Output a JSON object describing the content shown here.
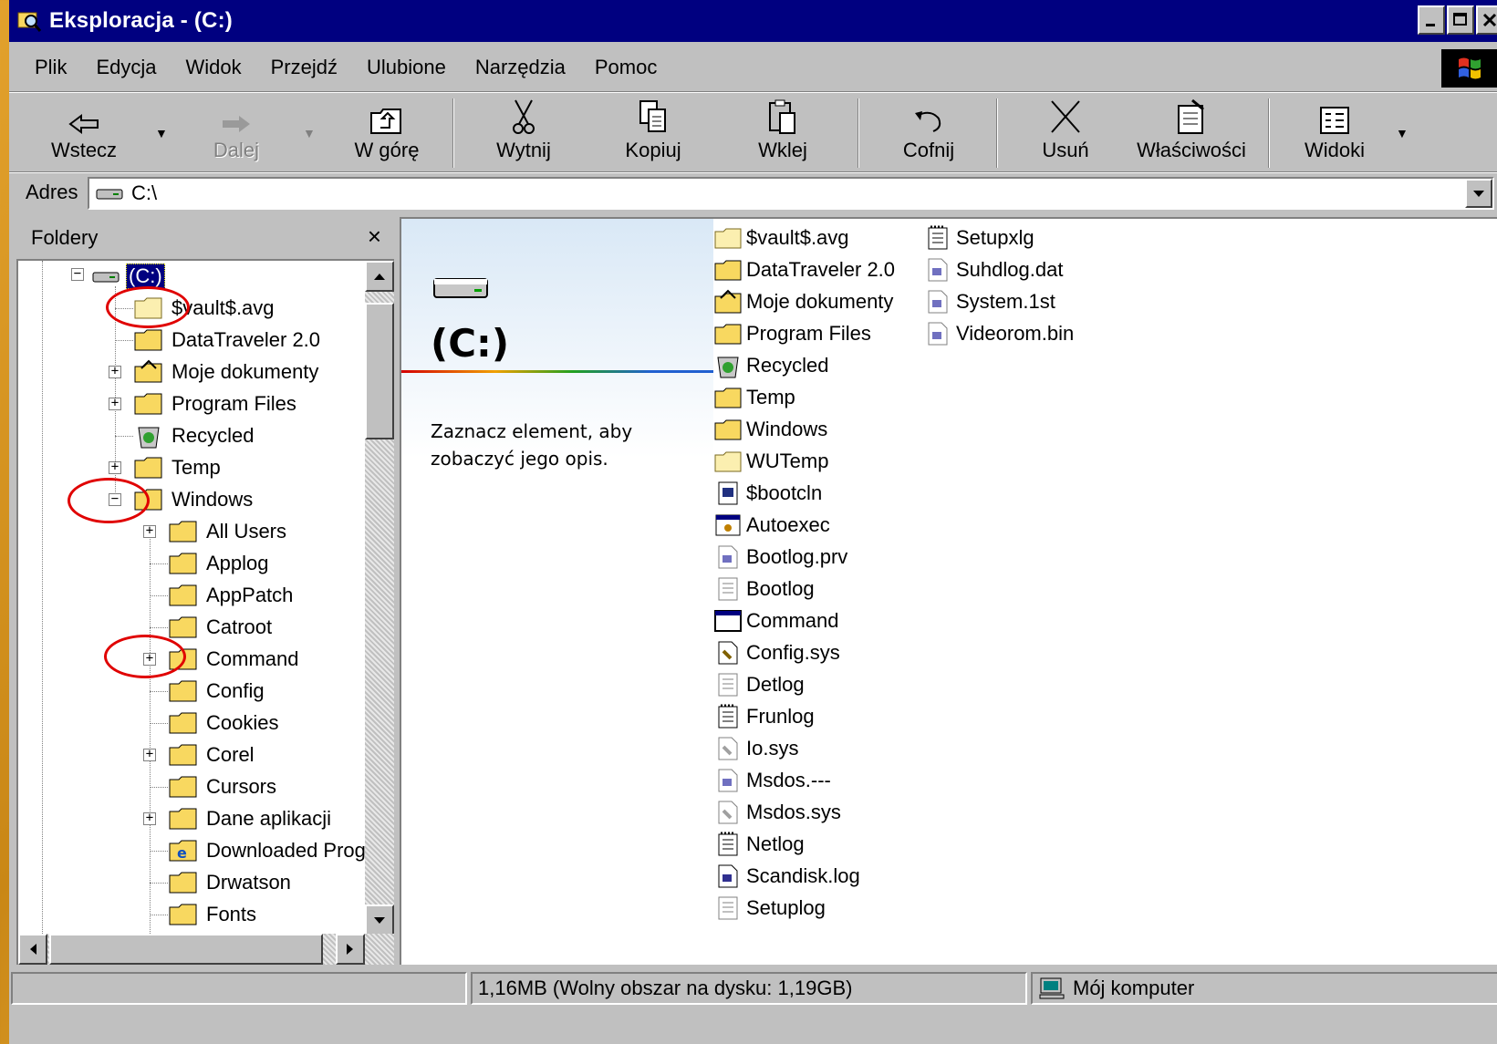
{
  "window": {
    "title": "Eksploracja -  (C:)"
  },
  "menu": [
    "Plik",
    "Edycja",
    "Widok",
    "Przejdź",
    "Ulubione",
    "Narzędzia",
    "Pomoc"
  ],
  "toolbar": {
    "back": "Wstecz",
    "forward": "Dalej",
    "up": "W górę",
    "cut": "Wytnij",
    "copy": "Kopiuj",
    "paste": "Wklej",
    "undo": "Cofnij",
    "delete": "Usuń",
    "properties": "Właściwości",
    "views": "Widoki"
  },
  "address": {
    "label": "Adres",
    "value": "C:\\"
  },
  "folders_pane": {
    "title": "Foldery",
    "close": "×",
    "root": "(C:)",
    "items": [
      {
        "label": "$vault$.avg",
        "icon": "folder-light"
      },
      {
        "label": "DataTraveler 2.0",
        "icon": "folder"
      },
      {
        "label": "Moje dokumenty",
        "icon": "folder-documents"
      },
      {
        "label": "Program Files",
        "icon": "folder"
      },
      {
        "label": "Recycled",
        "icon": "recycle-bin"
      },
      {
        "label": "Temp",
        "icon": "folder"
      },
      {
        "label": "Windows",
        "icon": "folder-open"
      }
    ],
    "windows_children": [
      {
        "label": "All Users",
        "icon": "folder"
      },
      {
        "label": "Applog",
        "icon": "folder"
      },
      {
        "label": "AppPatch",
        "icon": "folder"
      },
      {
        "label": "Catroot",
        "icon": "folder"
      },
      {
        "label": "Command",
        "icon": "folder"
      },
      {
        "label": "Config",
        "icon": "folder"
      },
      {
        "label": "Cookies",
        "icon": "folder"
      },
      {
        "label": "Corel",
        "icon": "folder"
      },
      {
        "label": "Cursors",
        "icon": "folder"
      },
      {
        "label": "Dane aplikacji",
        "icon": "folder"
      },
      {
        "label": "Downloaded Prog",
        "icon": "ie-folder"
      },
      {
        "label": "Drwatson",
        "icon": "folder"
      },
      {
        "label": "Fonts",
        "icon": "folder"
      }
    ]
  },
  "drive_panel": {
    "title": "(C:)",
    "hint": "Zaznacz element, aby zobaczyć jego opis."
  },
  "files_col1": [
    {
      "label": "$vault$.avg",
      "icon": "folder-light"
    },
    {
      "label": "DataTraveler 2.0",
      "icon": "folder"
    },
    {
      "label": "Moje dokumenty",
      "icon": "folder-documents"
    },
    {
      "label": "Program Files",
      "icon": "folder"
    },
    {
      "label": "Recycled",
      "icon": "recycle-bin"
    },
    {
      "label": "Temp",
      "icon": "folder"
    },
    {
      "label": "Windows",
      "icon": "folder"
    },
    {
      "label": "WUTemp",
      "icon": "folder-light"
    },
    {
      "label": "$bootcln",
      "icon": "sys-file"
    },
    {
      "label": "Autoexec",
      "icon": "batch-file"
    },
    {
      "label": "Bootlog.prv",
      "icon": "file-generic"
    },
    {
      "label": "Bootlog",
      "icon": "text-file"
    },
    {
      "label": "Command",
      "icon": "dos-window"
    },
    {
      "label": "Config.sys",
      "icon": "config-file"
    },
    {
      "label": "Detlog",
      "icon": "text-file"
    },
    {
      "label": "Frunlog",
      "icon": "notepad-file"
    },
    {
      "label": "Io.sys",
      "icon": "config-file"
    },
    {
      "label": "Msdos.---",
      "icon": "file-generic"
    },
    {
      "label": "Msdos.sys",
      "icon": "config-file"
    },
    {
      "label": "Netlog",
      "icon": "notepad-file"
    },
    {
      "label": "Scandisk.log",
      "icon": "file-generic"
    },
    {
      "label": "Setuplog",
      "icon": "text-file"
    }
  ],
  "files_col2": [
    {
      "label": "Setupxlg",
      "icon": "notepad-file"
    },
    {
      "label": "Suhdlog.dat",
      "icon": "file-generic"
    },
    {
      "label": "System.1st",
      "icon": "file-generic"
    },
    {
      "label": "Videorom.bin",
      "icon": "file-generic"
    }
  ],
  "status": {
    "left": "",
    "size": "1,16MB (Wolny obszar na dysku: 1,19GB)",
    "location": "Mój komputer"
  },
  "colors": {
    "titlebar": "#000080",
    "chrome": "#c0c0c0",
    "annotation": "#e00000",
    "folder": "#f8d860"
  }
}
